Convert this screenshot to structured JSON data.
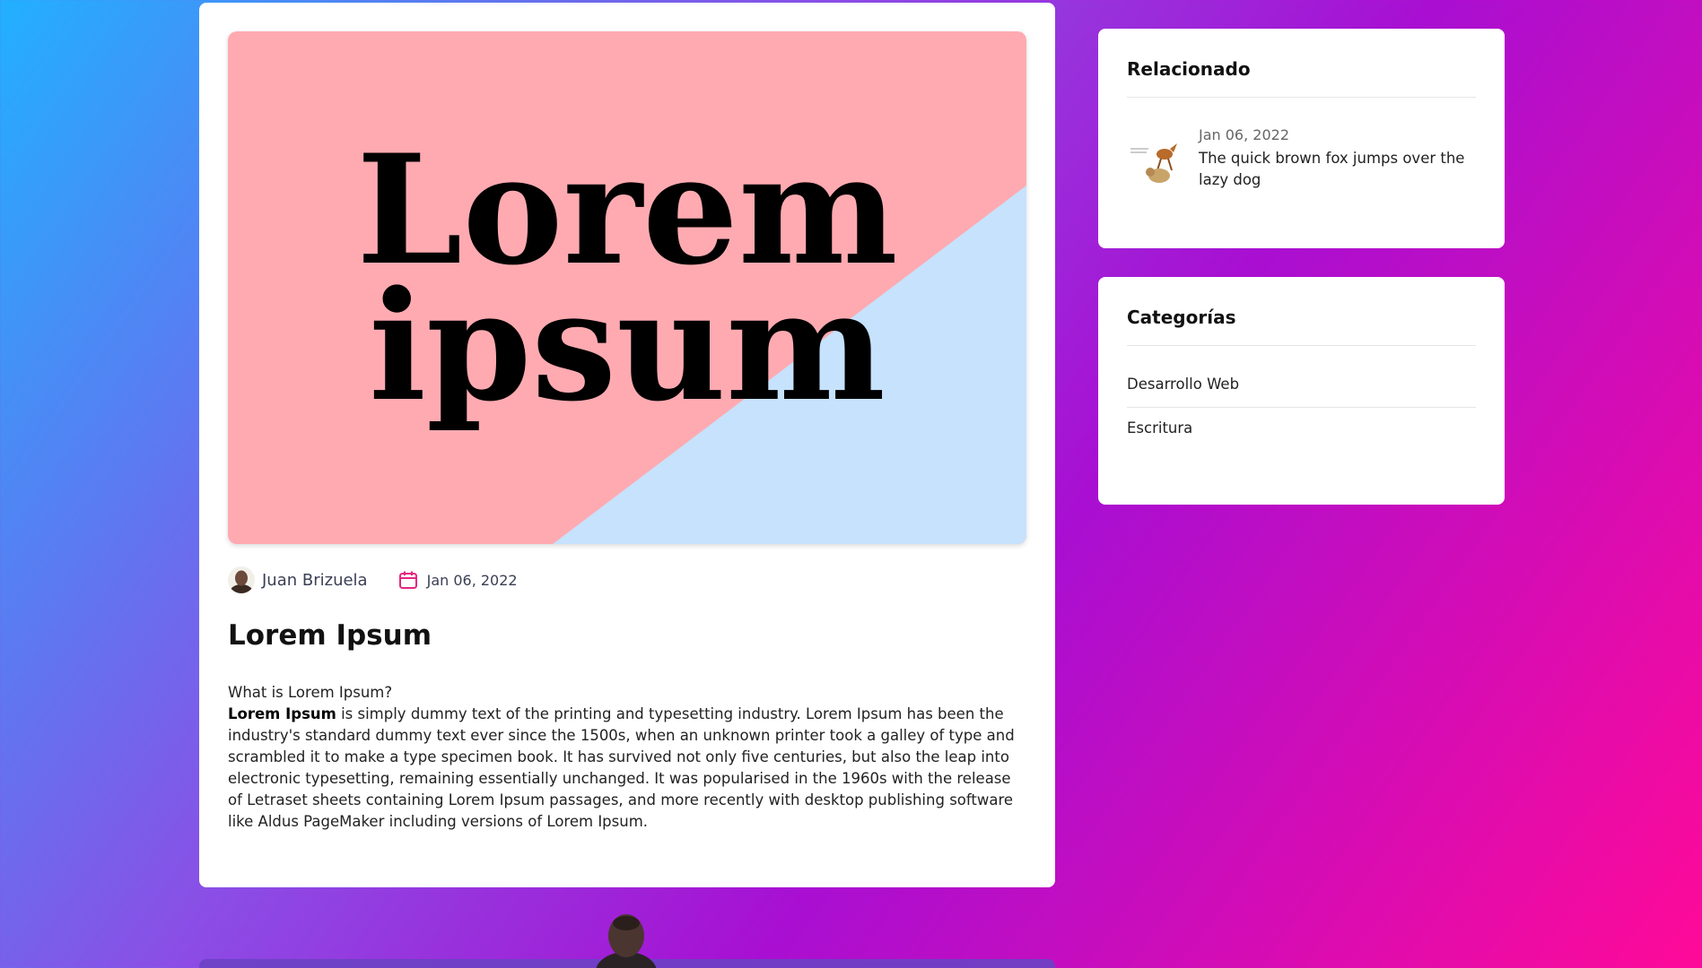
{
  "post": {
    "hero_text_line1": "Lorem",
    "hero_text_line2": "ipsum",
    "author": "Juan Brizuela",
    "date": "Jan 06, 2022",
    "title": "Lorem Ipsum",
    "question": "What is Lorem Ipsum?",
    "body_bold": "Lorem Ipsum",
    "body_rest": " is simply dummy text of the printing and typesetting industry. Lorem Ipsum has been the industry's standard dummy text ever since the 1500s, when an unknown printer took a galley of type and scrambled it to make a type specimen book. It has survived not only five centuries, but also the leap into electronic typesetting, remaining essentially unchanged. It was popularised in the 1960s with the release of Letraset sheets containing Lorem Ipsum passages, and more recently with desktop publishing software like Aldus PageMaker including versions of Lorem Ipsum."
  },
  "related": {
    "heading": "Relacionado",
    "items": [
      {
        "date": "Jan 06, 2022",
        "title": "The quick brown fox jumps over the lazy dog",
        "thumb_icon": "fox-dog-thumbnail"
      }
    ]
  },
  "categories": {
    "heading": "Categorías",
    "items": [
      {
        "label": "Desarrollo Web"
      },
      {
        "label": "Escritura"
      }
    ]
  },
  "colors": {
    "hero_pink": "#ffaab1",
    "hero_blue": "#c6e2fc",
    "calendar_accent": "#e4277f"
  },
  "icons": {
    "calendar": "calendar-icon",
    "author_avatar": "author-avatar"
  }
}
